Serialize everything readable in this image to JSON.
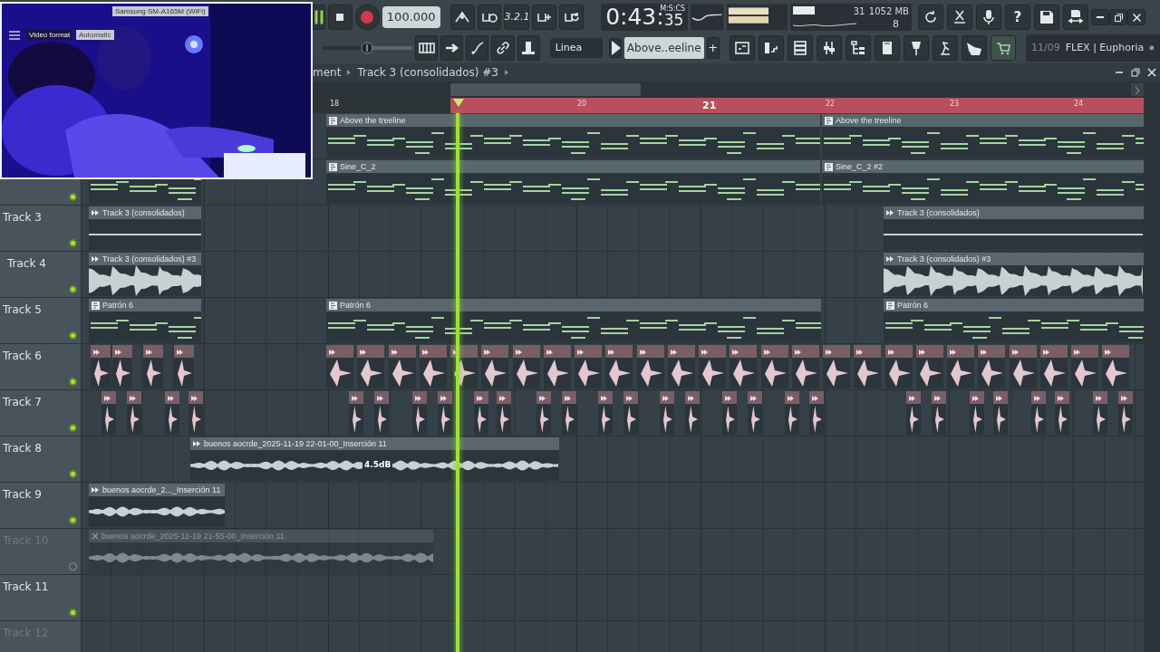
{
  "camera": {
    "kind": "picture",
    "device": "Samsung SM-A165M (WiFi)",
    "format_label": "Video format",
    "format_value": "Automatic"
  },
  "transport": {
    "tempo": "100.000",
    "countdown": "3.2.1",
    "time": "0:43:",
    "time_cs": "35",
    "time_unit": "M:S:CS"
  },
  "monitor": {
    "cpu": "31",
    "memory": "1052 MB",
    "voices": "8"
  },
  "help": "?",
  "master_pitch": {
    "level": 0.5
  },
  "snap": "Linea",
  "pattern_selector": {
    "value": "Above..eeline",
    "add": "+"
  },
  "hint": {
    "time": "11/09",
    "text": "FLEX | Euphoria"
  },
  "breadcrumb": [
    "ment",
    "Track 3 (consolidados) #3"
  ],
  "ruler": [
    {
      "label": "18",
      "highlight": false
    },
    {
      "label": "20",
      "highlight": false
    },
    {
      "label": "21",
      "highlight": true
    },
    {
      "label": "22",
      "highlight": false
    },
    {
      "label": "23",
      "highlight": false
    },
    {
      "label": "24",
      "highlight": false
    }
  ],
  "tracks": [
    {
      "clips": [
        {
          "kind": "pattern",
          "label": "Above the treeline",
          "muted": false
        },
        {
          "kind": "pattern",
          "label": "Above the treeline",
          "muted": false
        }
      ]
    },
    {
      "muted": false,
      "clips": [
        {
          "kind": "pattern",
          "muted": false
        },
        {
          "kind": "pattern",
          "label": "Sine_C_2",
          "muted": false
        },
        {
          "kind": "pattern",
          "label": "Sine_C_2 #2",
          "muted": false
        }
      ]
    },
    {
      "name": "Track 3",
      "muted": false,
      "clips": [
        {
          "kind": "audio",
          "label": "Track 3 (consolidados)",
          "muted": false
        },
        {
          "kind": "audio",
          "label": "Track 3 (consolidados)",
          "muted": false
        }
      ]
    },
    {
      "name": "Track 4",
      "muted": false,
      "clips": [
        {
          "kind": "audio",
          "label": "Track 3 (consolidados) #3",
          "muted": false
        },
        {
          "kind": "audio",
          "label": "Track 3 (consolidados) #3",
          "muted": false
        }
      ]
    },
    {
      "name": "Track 5",
      "muted": false,
      "clips": [
        {
          "kind": "pattern",
          "label": "Patrón 6",
          "muted": false
        },
        {
          "kind": "pattern",
          "label": "Patrón 6",
          "muted": false
        },
        {
          "kind": "pattern",
          "label": "Patrón 6",
          "muted": false
        }
      ]
    },
    {
      "name": "Track 6",
      "muted": false,
      "clips": [
        {
          "kind": "hits",
          "muted": false
        }
      ]
    },
    {
      "name": "Track 7",
      "muted": false,
      "clips": [
        {
          "kind": "hits",
          "muted": false
        }
      ]
    },
    {
      "name": "Track 8",
      "muted": false,
      "clips": [
        {
          "kind": "audio",
          "label": "buenos aocrde_2025-11-19 22-01-00_Inserción 11",
          "gain": "4.5dB",
          "muted": false
        }
      ]
    },
    {
      "name": "Track 9",
      "muted": false,
      "clips": [
        {
          "kind": "audio",
          "label": "buenos aocrde_2..._Inserción 11",
          "muted": false
        }
      ]
    },
    {
      "name": "Track 10",
      "muted": true,
      "clips": [
        {
          "kind": "audio",
          "label": "buenos aocrde_2025-11-19 21-55-00_Inserción 11",
          "muted": true
        }
      ]
    },
    {
      "name": "Track 11",
      "muted": false
    },
    {
      "name": "Track 12",
      "muted": true
    }
  ]
}
